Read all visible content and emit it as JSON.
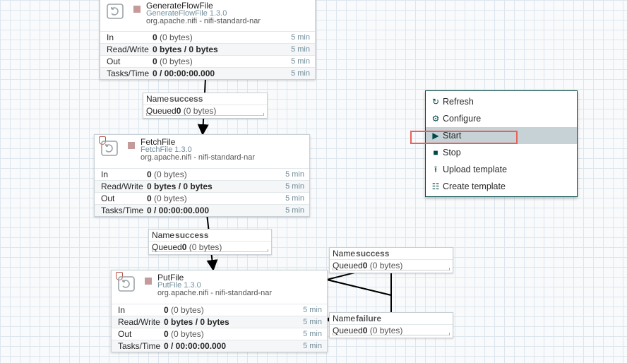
{
  "processors": [
    {
      "name": "GenerateFlowFile",
      "type": "GenerateFlowFile 1.3.0",
      "bundle": "org.apache.nifi - nifi-standard-nar",
      "stats": {
        "in_label": "In",
        "in_value": "0",
        "in_detail": "(0 bytes)",
        "in_window": "5 min",
        "rw_label": "Read/Write",
        "rw_value": "0 bytes / 0 bytes",
        "rw_window": "5 min",
        "out_label": "Out",
        "out_value": "0",
        "out_detail": "(0 bytes)",
        "out_window": "5 min",
        "tasks_label": "Tasks/Time",
        "tasks_value": "0 / 00:00:00.000",
        "tasks_window": "5 min"
      }
    },
    {
      "name": "FetchFile",
      "type": "FetchFile 1.3.0",
      "bundle": "org.apache.nifi - nifi-standard-nar",
      "stats": {
        "in_label": "In",
        "in_value": "0",
        "in_detail": "(0 bytes)",
        "in_window": "5 min",
        "rw_label": "Read/Write",
        "rw_value": "0 bytes / 0 bytes",
        "rw_window": "5 min",
        "out_label": "Out",
        "out_value": "0",
        "out_detail": "(0 bytes)",
        "out_window": "5 min",
        "tasks_label": "Tasks/Time",
        "tasks_value": "0 / 00:00:00.000",
        "tasks_window": "5 min"
      }
    },
    {
      "name": "PutFile",
      "type": "PutFile 1.3.0",
      "bundle": "org.apache.nifi - nifi-standard-nar",
      "stats": {
        "in_label": "In",
        "in_value": "0",
        "in_detail": "(0 bytes)",
        "in_window": "5 min",
        "rw_label": "Read/Write",
        "rw_value": "0 bytes / 0 bytes",
        "rw_window": "5 min",
        "out_label": "Out",
        "out_value": "0",
        "out_detail": "(0 bytes)",
        "out_window": "5 min",
        "tasks_label": "Tasks/Time",
        "tasks_value": "0 / 00:00:00.000",
        "tasks_window": "5 min"
      }
    }
  ],
  "connections": [
    {
      "name_key": "Name",
      "name": "success",
      "queued_key": "Queued",
      "queued_value": "0",
      "queued_detail": "(0 bytes)"
    },
    {
      "name_key": "Name",
      "name": "success",
      "queued_key": "Queued",
      "queued_value": "0",
      "queued_detail": "(0 bytes)"
    },
    {
      "name_key": "Name",
      "name": "success",
      "queued_key": "Queued",
      "queued_value": "0",
      "queued_detail": "(0 bytes)"
    },
    {
      "name_key": "Name",
      "name": "failure",
      "queued_key": "Queued",
      "queued_value": "0",
      "queued_detail": "(0 bytes)"
    }
  ],
  "context_menu": {
    "items": [
      {
        "label": "Refresh",
        "icon": "refresh-icon"
      },
      {
        "label": "Configure",
        "icon": "gear-icon"
      },
      {
        "label": "Start",
        "icon": "play-icon"
      },
      {
        "label": "Stop",
        "icon": "stop-icon"
      },
      {
        "label": "Upload template",
        "icon": "upload-template-icon"
      },
      {
        "label": "Create template",
        "icon": "create-template-icon"
      }
    ],
    "highlighted_item": "Start"
  },
  "colors": {
    "accent": "#004849",
    "status_stopped": "#c49a9a",
    "highlight_outline": "#e8625a",
    "type_text": "#728e9b"
  }
}
